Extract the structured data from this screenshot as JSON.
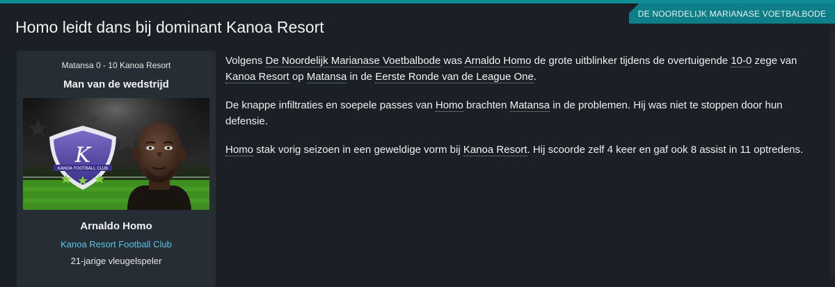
{
  "source": "DE NOORDELIJK MARIANASE VOETBALBODE",
  "headline": "Homo leidt dans bij dominant Kanoa Resort",
  "card": {
    "score": "Matansa 0 - 10 Kanoa Resort",
    "award": "Man van de wedstrijd",
    "player_name": "Arnaldo Homo",
    "club": "Kanoa Resort Football Club",
    "role": "21-jarige vleugelspeler",
    "badge_text": "KANOA FOOTBALL CLUB",
    "badge_letter": "K"
  },
  "article": {
    "p1": [
      {
        "t": "Volgens "
      },
      {
        "t": "De Noordelijk Marianase Voetbalbode",
        "link": true
      },
      {
        "t": " was "
      },
      {
        "t": "Arnaldo Homo",
        "link": true
      },
      {
        "t": " de grote uitblinker tijdens de overtuigende "
      },
      {
        "t": "10-0",
        "link": true
      },
      {
        "t": " zege van "
      },
      {
        "t": "Kanoa Resort",
        "link": true
      },
      {
        "t": " op "
      },
      {
        "t": "Matansa",
        "link": true
      },
      {
        "t": " in de "
      },
      {
        "t": "Eerste Ronde van de League One",
        "link": true
      },
      {
        "t": "."
      }
    ],
    "p2": [
      {
        "t": "De knappe infiltraties en soepele passes van "
      },
      {
        "t": "Homo",
        "link": true
      },
      {
        "t": " brachten "
      },
      {
        "t": "Matansa",
        "link": true
      },
      {
        "t": " in de problemen. Hij was niet te stoppen door hun defensie."
      }
    ],
    "p3": [
      {
        "t": "Homo",
        "link": true
      },
      {
        "t": " stak vorig seizoen in een geweldige vorm bij "
      },
      {
        "t": "Kanoa Resort",
        "link": true
      },
      {
        "t": ". Hij scoorde zelf 4 keer en gaf ook 8 assist in 11 optredens."
      }
    ]
  },
  "colors": {
    "accent": "#0f8d97",
    "club_link": "#58c6e6",
    "background": "#1b2026",
    "card": "#272d34"
  }
}
